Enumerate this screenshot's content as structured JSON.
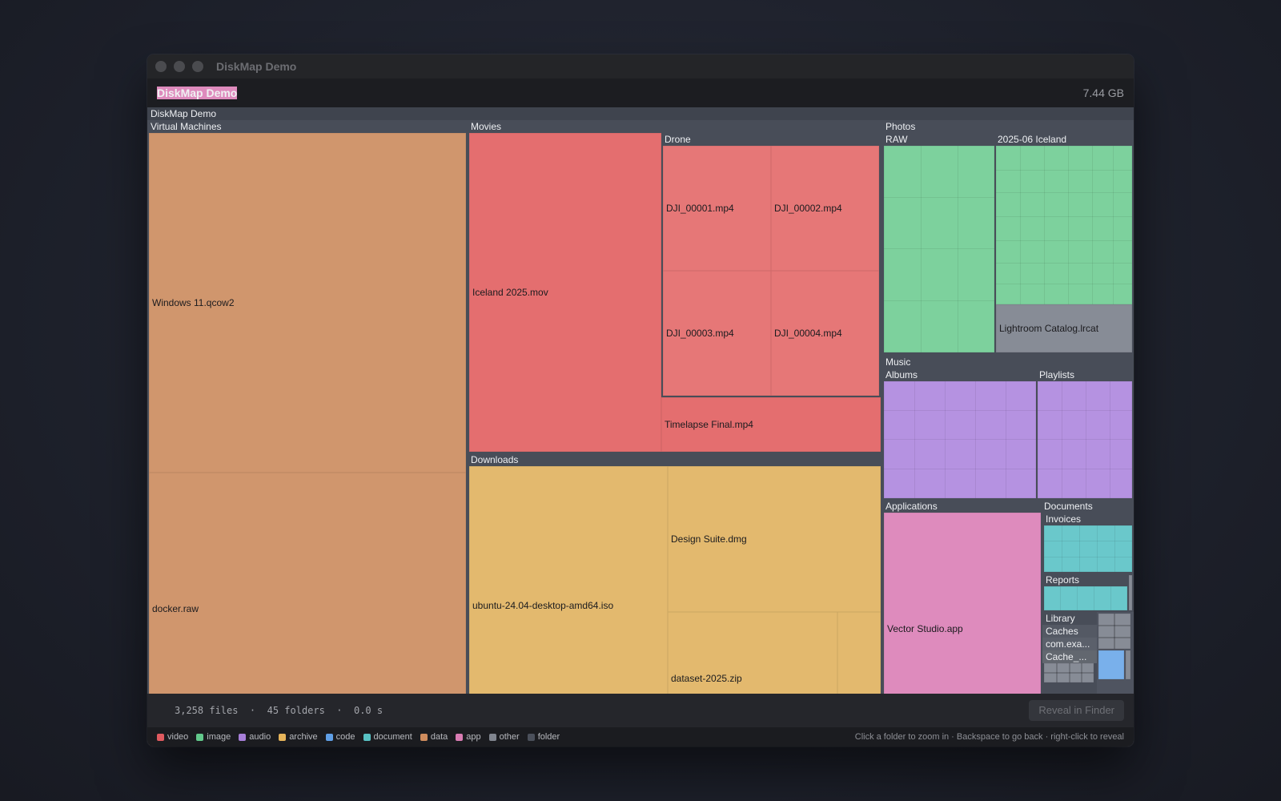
{
  "window": {
    "title": "DiskMap Demo"
  },
  "header": {
    "app_name": "DiskMap Demo",
    "total_size": "7.44 GB"
  },
  "treemap": {
    "root": "DiskMap Demo",
    "virtual_machines": {
      "label": "Virtual Machines",
      "files": [
        "Windows 11.qcow2",
        "docker.raw"
      ]
    },
    "movies": {
      "label": "Movies",
      "iceland": "Iceland 2025.mov",
      "drone": {
        "label": "Drone",
        "files": [
          "DJI_00001.mp4",
          "DJI_00002.mp4",
          "DJI_00003.mp4",
          "DJI_00004.mp4"
        ]
      },
      "timelapse": "Timelapse Final.mp4"
    },
    "downloads": {
      "label": "Downloads",
      "files": [
        "ubuntu-24.04-desktop-amd64.iso",
        "Design Suite.dmg",
        "dataset-2025.zip"
      ]
    },
    "photos": {
      "label": "Photos",
      "raw": "RAW",
      "iceland": "2025-06 Iceland",
      "catalog": "Lightroom Catalog.lrcat"
    },
    "music": {
      "label": "Music",
      "albums": "Albums",
      "playlists": "Playlists"
    },
    "applications": {
      "label": "Applications",
      "vector": "Vector Studio.app"
    },
    "documents": {
      "label": "Documents",
      "invoices": "Invoices",
      "reports": "Reports",
      "library": {
        "label": "Library",
        "caches": "Caches",
        "com": "com.exa...",
        "cache": "Cache_..."
      }
    }
  },
  "status": {
    "stats": "3,258 files  ·  45 folders  ·  0.0 s",
    "reveal_button": "Reveal in Finder"
  },
  "legend": [
    {
      "label": "video",
      "color": "#e05a5f"
    },
    {
      "label": "image",
      "color": "#62c98b"
    },
    {
      "label": "audio",
      "color": "#a77fd9"
    },
    {
      "label": "archive",
      "color": "#e6b45a"
    },
    {
      "label": "code",
      "color": "#5f9fe6"
    },
    {
      "label": "document",
      "color": "#58c2c4"
    },
    {
      "label": "data",
      "color": "#cf8c5d"
    },
    {
      "label": "app",
      "color": "#d97cb3"
    },
    {
      "label": "other",
      "color": "#80858f"
    },
    {
      "label": "folder",
      "color": "#4b505b"
    }
  ],
  "hint": "Click a folder to zoom in · Backspace to go back · right-click to reveal"
}
